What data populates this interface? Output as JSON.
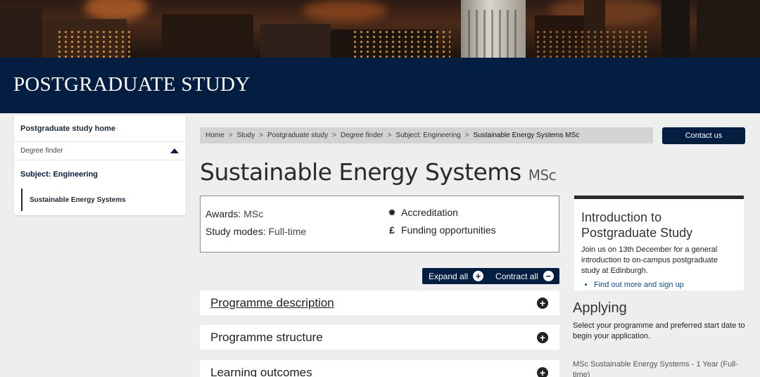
{
  "banner": {
    "title": "POSTGRADUATE STUDY"
  },
  "sidebar": {
    "home": "Postgraduate study home",
    "finder": "Degree finder",
    "subject": "Subject: Engineering",
    "current": "Sustainable Energy Systems"
  },
  "breadcrumb": [
    "Home",
    "Study",
    "Postgraduate study",
    "Degree finder",
    "Subject: Engineering",
    "Sustainable Energy Systems MSc"
  ],
  "breadcrumb_sep": ">",
  "contact_label": "Contact us",
  "programme": {
    "name": "Sustainable Energy Systems",
    "award": "MSc"
  },
  "facts": {
    "awards_label": "Awards:",
    "awards_value": "MSc",
    "modes_label": "Study modes:",
    "modes_value": "Full-time",
    "accreditation": "Accreditation",
    "funding": "Funding opportunities"
  },
  "controls": {
    "expand": "Expand all",
    "contract": "Contract all"
  },
  "sections": [
    "Programme description",
    "Programme structure",
    "Learning outcomes"
  ],
  "intro_card": {
    "title": "Introduction to Postgraduate Study",
    "text": "Join us on 13th December for a general introduction to on-campus postgraduate study at Edinburgh.",
    "link": "Find out more and sign up"
  },
  "applying": {
    "title": "Applying",
    "text": "Select your programme and preferred start date to begin your application.",
    "option": "MSc Sustainable Energy Systems - 1 Year (Full-time)"
  },
  "colors": {
    "brand_navy": "#041e42",
    "link_blue": "#0b4e9b",
    "breadcrumb_bg": "#d3d3d3"
  }
}
